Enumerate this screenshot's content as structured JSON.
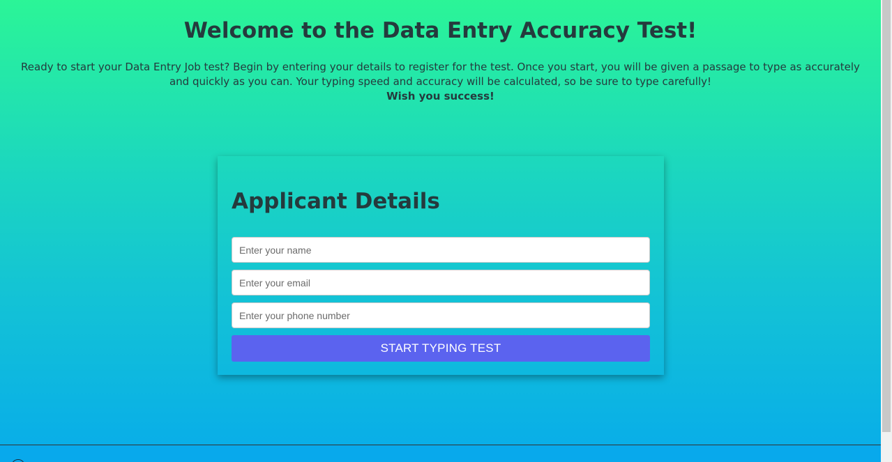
{
  "page": {
    "title": "Welcome to the Data Entry Accuracy Test!",
    "intro": "Ready to start your Data Entry Job test? Begin by entering your details to register for the test. Once you start, you will be given a passage to type as accurately and quickly as you can. Your typing speed and accuracy will be calculated, so be sure to type carefully!",
    "wish": "Wish you success!"
  },
  "form": {
    "title": "Applicant Details",
    "name_placeholder": "Enter your name",
    "email_placeholder": "Enter your email",
    "phone_placeholder": "Enter your phone number",
    "submit_label": "START TYPING TEST"
  },
  "colors": {
    "background_top": "#2bf597",
    "background_bottom": "#08acea",
    "button": "#5b63ef",
    "text": "#253a3d"
  }
}
